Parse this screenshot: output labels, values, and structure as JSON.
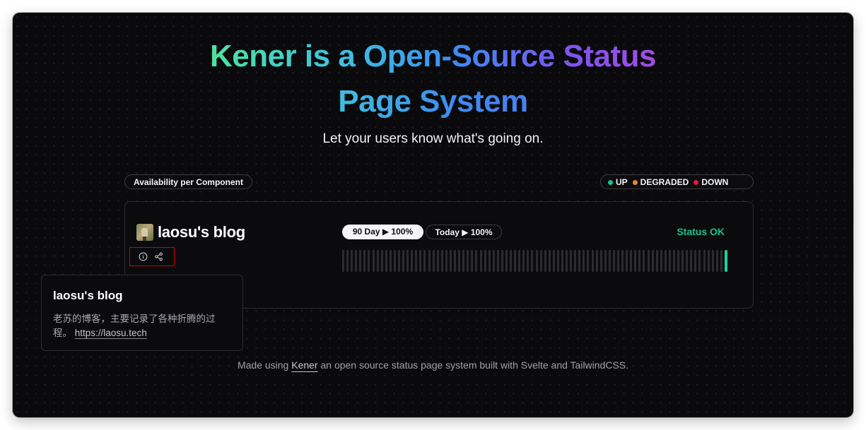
{
  "hero": {
    "title_part1": "Kener is a Open-Source Status",
    "title_part2": "Page System",
    "subtitle": "Let your users know what's going on."
  },
  "availability": {
    "label": "Availability per Component"
  },
  "legend": [
    {
      "label": "UP",
      "color": "#18c487"
    },
    {
      "label": "DEGRADED",
      "color": "#e08a2e"
    },
    {
      "label": "DOWN",
      "color": "#e5154a"
    }
  ],
  "monitor": {
    "name": "laosu's blog",
    "range_90_day": "90 Day ▶ 100%",
    "range_today": "Today ▶ 100%",
    "status": "Status OK",
    "status_color": "#18c487",
    "bar_count": 90,
    "bar_ok_color": "#18d49a",
    "bar_empty_color": "#2b2b30"
  },
  "icons": {
    "info": "info-icon",
    "share": "share-icon"
  },
  "tooltip": {
    "title": "laosu's blog",
    "description": "老苏的博客，主要记录了各种折腾的过程。",
    "link": "https://laosu.tech"
  },
  "footer": {
    "prefix": "Made using",
    "link": "Kener",
    "suffix": "an open source status page system built with Svelte and TailwindCSS."
  }
}
